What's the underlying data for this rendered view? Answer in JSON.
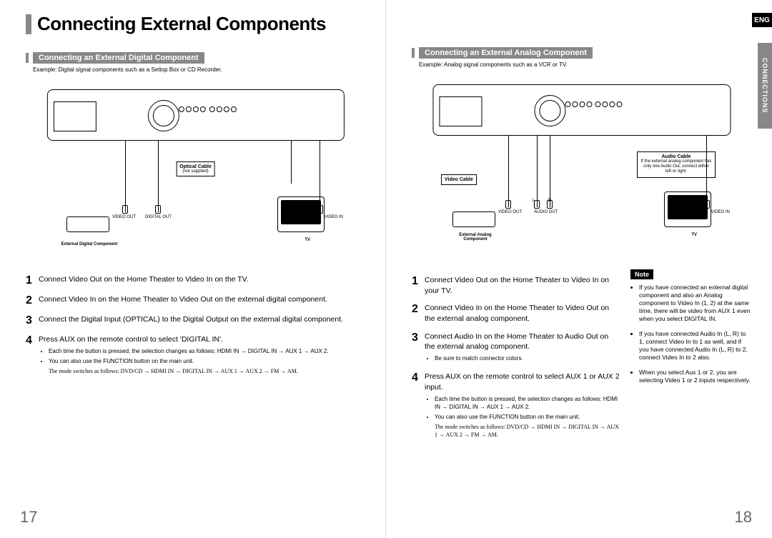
{
  "lang_tab": "ENG",
  "side_tab": "CONNECTIONS",
  "main_title": "Connecting External Components",
  "page_left_num": "17",
  "page_right_num": "18",
  "left": {
    "section_heading": "Connecting an External Digital Component",
    "example": "Example: Digital signal components such as a Settop Box or CD Recorder.",
    "diagram": {
      "optical_cable": "Optical Cable",
      "optical_cable_sub": "(not supplied)",
      "ext_component": "External Digital Component",
      "ext_ports": {
        "video_out": "VIDEO OUT",
        "digital_out": "DIGITAL OUT"
      },
      "tv": "TV",
      "tv_port": "VIDEO IN"
    },
    "steps": [
      {
        "num": "1",
        "text": "Connect Video Out on the Home Theater to Video In on the TV."
      },
      {
        "num": "2",
        "text": "Connect Video In on the Home Theater to Video Out on the external digital component."
      },
      {
        "num": "3",
        "text": "Connect the Digital Input (OPTICAL) to the Digital Output on the external digital component."
      },
      {
        "num": "4",
        "text": "Press AUX on the remote control to select 'DIGITAL IN'.",
        "bullets": [
          "Each time the button is pressed, the selection changes as follows: HDMI IN → DIGITAL IN → AUX 1 → AUX 2.",
          "You can also use the FUNCTION button on the main unit."
        ],
        "serif_note": "The mode switches as follows: DVD/CD → HDMI IN → DIGITAL IN → AUX 1 → AUX 2 → FM → AM."
      }
    ]
  },
  "right": {
    "section_heading": "Connecting an External Analog Component",
    "example": "Example: Analog signal components such as a VCR or TV.",
    "diagram": {
      "video_cable": "Video Cable",
      "audio_cable": "Audio Cable",
      "audio_cable_sub": "If the external analog component has only one Audio Out, connect either left or right.",
      "ext_component": "External Analog Component",
      "ext_ports": {
        "video_out": "VIDEO OUT",
        "audio_out": "AUDIO OUT",
        "l": "L",
        "r": "R"
      },
      "tv": "TV",
      "tv_port": "VIDEO IN"
    },
    "steps": [
      {
        "num": "1",
        "text": "Connect Video Out on the Home Theater to Video In on your TV."
      },
      {
        "num": "2",
        "text": "Connect Video In on the Home Theater to Video Out on the external analog component."
      },
      {
        "num": "3",
        "text": "Connect Audio In on the Home Theater to Audio Out on the external analog component.",
        "bullets": [
          "Be sure to match connector colors."
        ]
      },
      {
        "num": "4",
        "text": "Press AUX on the remote control to select AUX 1 or AUX 2 input.",
        "bullets": [
          "Each time the button is pressed, the selection changes as follows: HDMI IN → DIGITAL IN → AUX 1 → AUX 2.",
          "You can also use the FUNCTION button on the main unit."
        ],
        "serif_note": "The mode switches as follows: DVD/CD → HDMI IN → DIGITAL IN → AUX 1 → AUX 2 → FM → AM."
      }
    ],
    "note_label": "Note",
    "notes": [
      "If you have connected an external digital component and also an Analog component to Video In (1, 2) at the same time, there will be video from AUX 1 even when you select DIGITAL IN.",
      "If you have connected Audio In (L, R) to 1, connect Video In to 1 as well, and if you have connected Audio In (L, R) to 2, connect Video In to 2 also.",
      "When you select Aux 1 or 2, you are selecting Video 1 or 2 inputs respectively."
    ]
  }
}
